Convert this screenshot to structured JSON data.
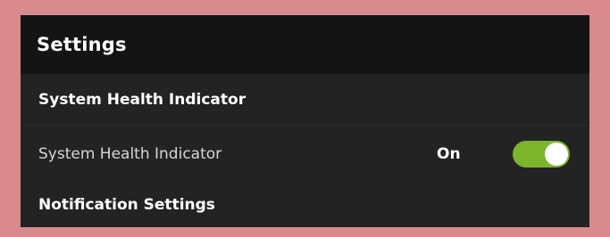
{
  "header": {
    "title": "Settings"
  },
  "sections": [
    {
      "heading": "System Health Indicator",
      "rows": [
        {
          "label": "System Health Indicator",
          "state_text": "On",
          "enabled": true
        }
      ]
    },
    {
      "heading": "Notification Settings"
    }
  ],
  "colors": {
    "page_background": "#d98a8c",
    "panel_background": "#232323",
    "header_background": "#141414",
    "toggle_on": "#7ab52b",
    "toggle_knob": "#ffffff"
  }
}
